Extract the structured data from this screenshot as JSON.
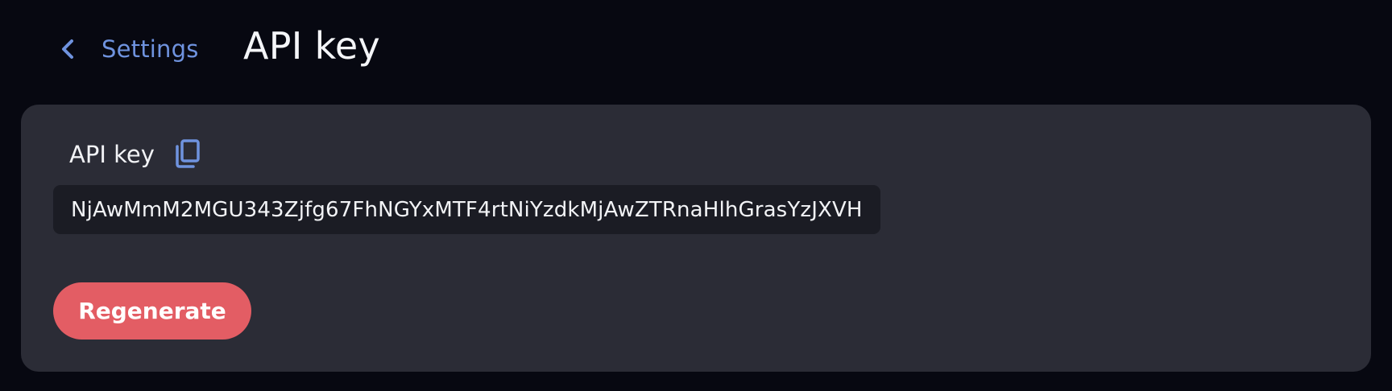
{
  "header": {
    "back_label": "Settings",
    "back_icon": "chevron-left-icon",
    "title": "API key"
  },
  "card": {
    "field_label": "API key",
    "copy_icon": "copy-icon",
    "api_key_value": "NjAwMmM2MGU343Zjfg67FhNGYxMTF4rtNiYzdkMjAwZTRnaHlhGrasYzJXVH",
    "regenerate_label": "Regenerate"
  },
  "colors": {
    "background": "#070811",
    "card": "#2b2c36",
    "input": "#1b1c24",
    "accent_link": "#6f93df",
    "danger": "#e35d64",
    "text": "#f2f3f6"
  }
}
